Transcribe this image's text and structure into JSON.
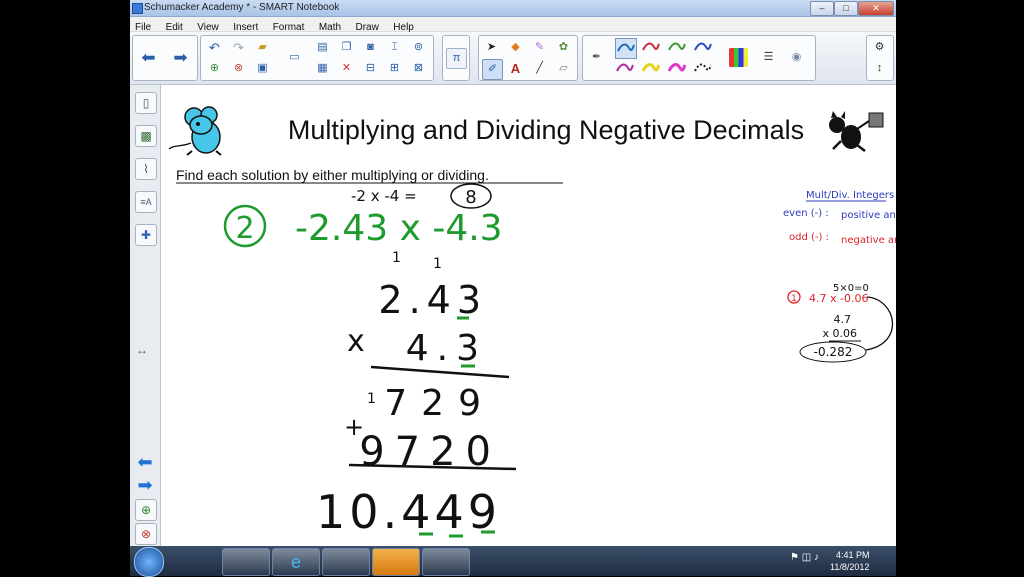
{
  "window": {
    "title": "Schumacker Academy * - SMART Notebook"
  },
  "window_controls": {
    "minimize": "–",
    "maximize": "□",
    "close": "✕"
  },
  "menu": [
    "File",
    "Edit",
    "View",
    "Insert",
    "Format",
    "Math",
    "Draw",
    "Help"
  ],
  "toolbar": {
    "pi_symbol": "π",
    "text_tool_symbol": "A",
    "icons": [
      "back-arrow-icon",
      "forward-arrow-icon",
      "undo-icon",
      "redo-icon",
      "open-folder-icon",
      "add-page-icon",
      "delete-icon",
      "save-icon",
      "screen-shade-icon",
      "table-icon",
      "select-icon",
      "magic-pen-icon",
      "text-icon",
      "line-icon",
      "eraser-icon",
      "pen-icon",
      "color-palette-icon",
      "properties-icon",
      "settings-icon"
    ]
  },
  "sidebar": {
    "icons": [
      "page-sorter-icon",
      "gallery-icon",
      "attachments-icon",
      "properties-icon",
      "addons-icon",
      "resize-handle-icon",
      "previous-page-icon",
      "next-page-icon",
      "add-page-icon",
      "delete-page-icon"
    ],
    "resize_symbol": "↔"
  },
  "page": {
    "title": "Multiplying and Dividing Negative Decimals",
    "instruction": "Find each solution by either multiplying or dividing.",
    "warmup": {
      "expr": "-2 x -4 =",
      "answer": "8"
    },
    "problem": {
      "number": "2",
      "expr": "-2.43 x -4.3"
    },
    "work": {
      "carries": [
        "1",
        "1"
      ],
      "multiplicand": "2.43",
      "multiplier_sign": "x",
      "multiplier": "4.3",
      "partial1_carry": "1",
      "partial1": "729",
      "plus_sign": "+",
      "partial2": "9720",
      "product": "10.449"
    },
    "notes": {
      "heading": "Mult/Div. Integers",
      "even_label": "even (-) :",
      "even_value": "positive answer",
      "odd_label": "odd (-) :",
      "odd_value": "negative answer",
      "example_top": "5×0=0",
      "example_number": "1",
      "example_expr": "4.7 x -0.06",
      "example_a": "4.7",
      "example_b": "x 0.06",
      "example_result": "-0.282"
    },
    "colors": {
      "green": "#1e9a2e",
      "blue": "#2b3bbf",
      "red": "#d8262b",
      "title": "#111111"
    }
  },
  "taskbar": {
    "time": "4:41 PM",
    "date": "11/8/2012"
  }
}
